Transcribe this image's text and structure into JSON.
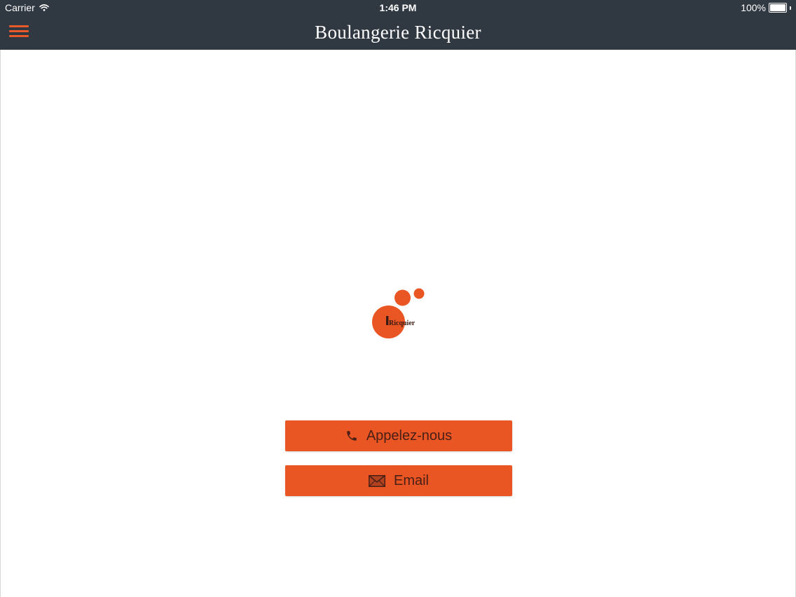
{
  "status_bar": {
    "carrier": "Carrier",
    "time": "1:46 PM",
    "battery": "100%"
  },
  "nav": {
    "title": "Boulangerie Ricquier",
    "menu_icon": "hamburger-menu-icon"
  },
  "logo": {
    "text": "Ricquier",
    "brand_color": "#ea5524"
  },
  "actions": {
    "call_label": "Appelez-nous",
    "call_icon": "phone-icon",
    "email_label": "Email",
    "email_icon": "envelope-icon"
  },
  "colors": {
    "nav_background": "#303841",
    "accent": "#ea5524",
    "button_text": "#4a2016",
    "background": "#ffffff"
  }
}
